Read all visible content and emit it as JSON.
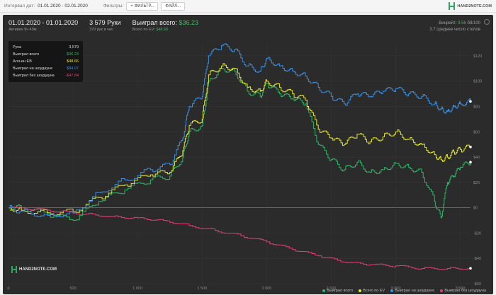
{
  "toolbar": {
    "interval_label": "Интервал дат:",
    "interval_value": "01.01.2020 - 02.01.2020",
    "filters_label": "Фильтры:",
    "filter_button": "ФИЛЬТР...",
    "file_button": "ФАЙЛ...",
    "logo": "HAND2NOTE.COM"
  },
  "summary": {
    "date_range": "01.01.2020 - 01.01.2020",
    "active": "Активен 9ч 40м",
    "hands": "3 579 Руки",
    "hands_rate": "370 рук в час",
    "won_total_label": "Выиграл всего:",
    "won_total_value": "$36.23",
    "ev_label": "Всего по EV:",
    "ev_value": "$48.66",
    "winrate_label": "Винрейт:",
    "winrate_value": "9.56",
    "winrate_unit": "бб/100",
    "tables": "3.7 среднее число столов"
  },
  "tooltip": {
    "rows": [
      {
        "label": "Рука",
        "value": "3,579"
      },
      {
        "label": "Выиграл всего",
        "value": "$36.23"
      },
      {
        "label": "Алл-ин EB",
        "value": "$48.66"
      },
      {
        "label": "Выиграл на шоудауне",
        "value": "$84.07"
      },
      {
        "label": "Выиграл без шоудауна",
        "value": "-$47.84"
      }
    ]
  },
  "watermark": "HAND2NOTE.COM",
  "colors": {
    "won_total": "#2fb566",
    "ev": "#e6e62a",
    "showdown": "#3a8fe0",
    "non_showdown": "#e0407a"
  },
  "chart_data": {
    "type": "line",
    "x_ticks": [
      "0",
      "500",
      "1 000",
      "1 500",
      "2 000",
      "2 500",
      "3 000",
      "3 500"
    ],
    "y_ticks": [
      "$120",
      "$100",
      "$80",
      "$60",
      "$40",
      "$20",
      "$0",
      "-$20",
      "-$40",
      "-$60"
    ],
    "xlim": [
      0,
      3579
    ],
    "ylim": [
      -60,
      130
    ],
    "series": [
      {
        "name": "Выиграл всего",
        "color": "#2fb566",
        "x": [
          0,
          100,
          300,
          500,
          700,
          900,
          1100,
          1250,
          1350,
          1400,
          1500,
          1550,
          1650,
          1750,
          1850,
          1950,
          2000,
          2100,
          2200,
          2300,
          2400,
          2500,
          2600,
          2700,
          2800,
          2900,
          3000,
          3100,
          3200,
          3300,
          3350,
          3400,
          3450,
          3500,
          3579
        ],
        "y": [
          0,
          0,
          -5,
          -10,
          5,
          14,
          22,
          25,
          40,
          60,
          65,
          100,
          110,
          108,
          92,
          88,
          98,
          90,
          86,
          82,
          50,
          38,
          30,
          36,
          28,
          30,
          35,
          32,
          28,
          5,
          -8,
          20,
          25,
          32,
          36
        ]
      },
      {
        "name": "Всего по EV",
        "color": "#e6e62a",
        "x": [
          0,
          100,
          300,
          500,
          700,
          900,
          1100,
          1250,
          1350,
          1400,
          1500,
          1550,
          1650,
          1750,
          1850,
          1950,
          2000,
          2100,
          2200,
          2300,
          2400,
          2500,
          2600,
          2700,
          2800,
          2900,
          3000,
          3100,
          3200,
          3300,
          3350,
          3400,
          3450,
          3500,
          3579
        ],
        "y": [
          0,
          -2,
          -4,
          -3,
          8,
          18,
          26,
          28,
          45,
          65,
          70,
          105,
          112,
          110,
          95,
          92,
          100,
          95,
          90,
          85,
          62,
          55,
          50,
          58,
          52,
          56,
          60,
          54,
          50,
          42,
          38,
          40,
          44,
          46,
          48
        ]
      },
      {
        "name": "Выиграл на шоудауне",
        "color": "#3a8fe0",
        "x": [
          0,
          100,
          300,
          500,
          700,
          900,
          1100,
          1250,
          1350,
          1400,
          1500,
          1550,
          1650,
          1750,
          1850,
          1950,
          2000,
          2100,
          2200,
          2300,
          2400,
          2500,
          2600,
          2700,
          2800,
          2900,
          3000,
          3100,
          3200,
          3300,
          3350,
          3400,
          3450,
          3500,
          3579
        ],
        "y": [
          0,
          -3,
          -6,
          -4,
          12,
          22,
          30,
          34,
          55,
          80,
          88,
          120,
          128,
          125,
          112,
          108,
          118,
          112,
          108,
          104,
          95,
          88,
          82,
          90,
          88,
          92,
          94,
          90,
          88,
          82,
          78,
          76,
          80,
          82,
          84
        ]
      },
      {
        "name": "Выиграл без шоудауна",
        "color": "#e0407a",
        "x": [
          0,
          200,
          400,
          600,
          800,
          1000,
          1200,
          1400,
          1600,
          1800,
          2000,
          2200,
          2400,
          2600,
          2800,
          3000,
          3200,
          3400,
          3579
        ],
        "y": [
          0,
          -1,
          -3,
          -5,
          -7,
          -8,
          -10,
          -14,
          -18,
          -22,
          -27,
          -33,
          -38,
          -43,
          -45,
          -46,
          -48,
          -48,
          -47.84
        ]
      }
    ]
  }
}
